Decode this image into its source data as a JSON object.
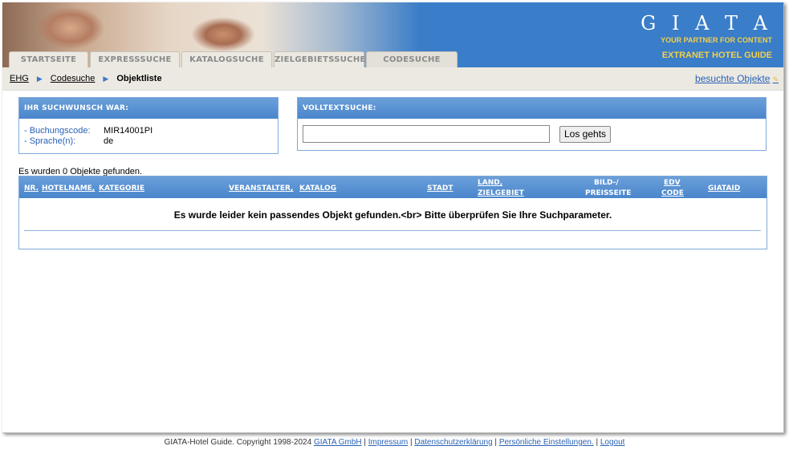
{
  "logo": {
    "letters": "G I A T A",
    "tagline": "YOUR PARTNER FOR CONTENT",
    "product": "EXTRANET HOTEL GUIDE"
  },
  "tabs": [
    {
      "label": "Startseite"
    },
    {
      "label": "Expresssuche"
    },
    {
      "label": "Katalogsuche"
    },
    {
      "label": "Zielgebietssuche"
    },
    {
      "label": "Codesuche"
    }
  ],
  "breadcrumb": {
    "home": "EHG",
    "parent": "Codesuche",
    "current": "Objektliste"
  },
  "visited_link": "besuchte Objekte",
  "criteria": {
    "title": "Ihr Suchwunsch war:",
    "items": [
      {
        "label": "- Buchungscode:",
        "value": "MIR14001PI"
      },
      {
        "label": "- Sprache(n):",
        "value": "de"
      }
    ]
  },
  "fulltext": {
    "title": "Volltextsuche:",
    "value": "",
    "button": "Los gehts"
  },
  "result_count": "Es wurden 0 Objekte gefunden.",
  "table": {
    "columns": {
      "nr": "Nr.",
      "hotelname": "Hotelname,",
      "kategorie": "Kategorie",
      "veranstalter": "Veranstalter,",
      "katalog": "Katalog",
      "stadt": "Stadt",
      "land": "Land,",
      "zielgebiet": "Zielgebiet",
      "bild": "Bild-/",
      "preisseite": "Preisseite",
      "edv": "EDV",
      "code": "Code",
      "giataid": "GIATAID"
    },
    "empty_message": "Es wurde leider kein passendes Objekt gefunden.<br> Bitte überprüfen Sie Ihre Suchparameter."
  },
  "footer": {
    "copyright": "GIATA-Hotel Guide. Copyright 1998-2024",
    "links": [
      "GIATA GmbH",
      "Impressum",
      "Datenschutzerklärung",
      "Persönliche Einstellungen.",
      "Logout"
    ]
  },
  "colors": {
    "header_blue": "#3a7dc8",
    "logo_yellow": "#f2d04a",
    "link_blue": "#2a62b5",
    "box_border": "#7fa9d9"
  }
}
